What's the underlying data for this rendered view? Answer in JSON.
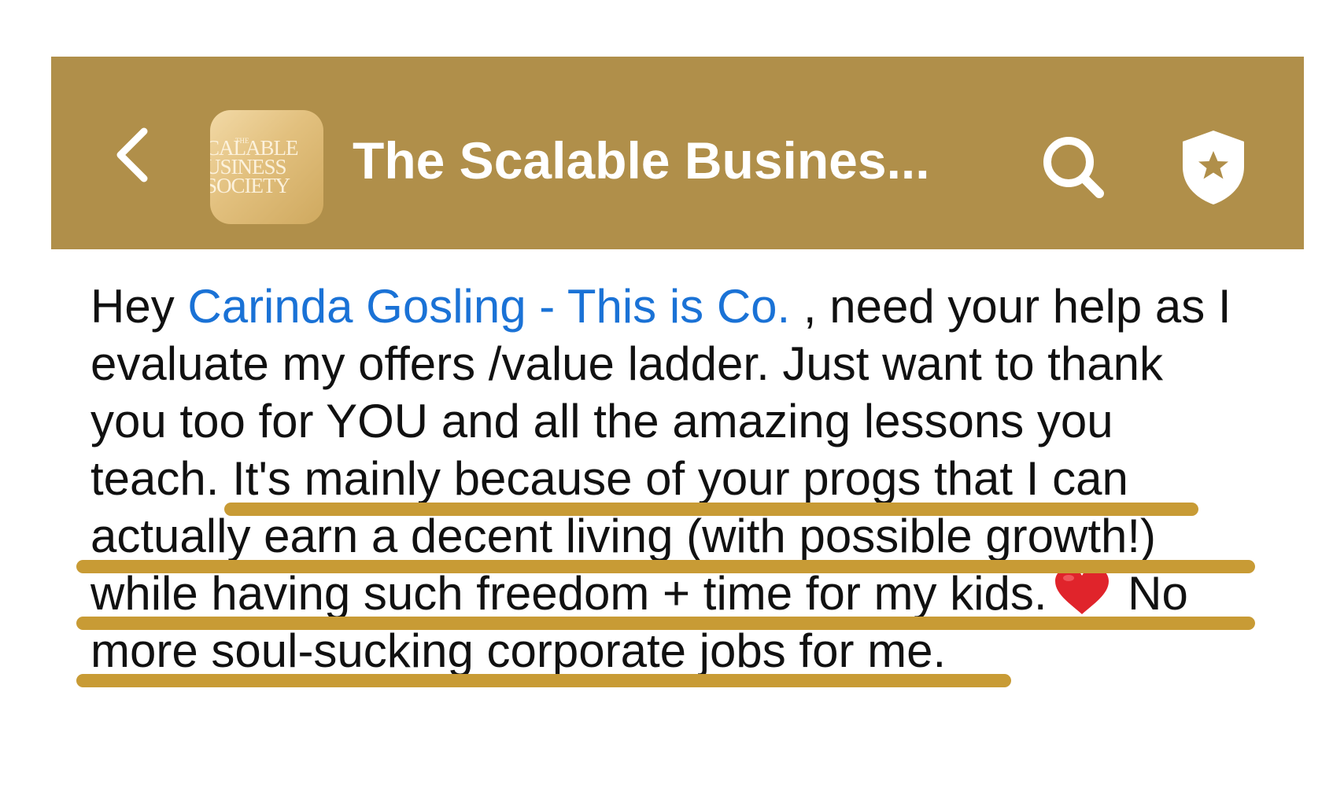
{
  "header": {
    "back_icon": "chevron-left-icon",
    "avatar_text": "CALABLE\nUSINESS\nSOCIETY",
    "avatar_small_text": "THE",
    "title": "The Scalable Busines...",
    "search_icon": "search-icon",
    "shield_icon": "shield-star-icon",
    "background_color": "#b08f4a"
  },
  "message": {
    "line1_prefix": "Hey ",
    "mention": "Carinda Gosling - This is Co.",
    "line1_suffix": " , need your help as I",
    "line2": "evaluate my offers /value ladder. Just want to thank",
    "line3": "you too for YOU and all the amazing lessons you",
    "line4": "teach. It's mainly because of your progs that I can",
    "line5": "actually earn a decent living (with possible growth!)",
    "line6_prefix": "while having such freedom + time for my kids.",
    "line6_suffix": " No",
    "line7": "more soul-sucking corporate jobs for me.",
    "emoji": "heart",
    "mention_color": "#1a72d6",
    "highlight_color": "#c89b35"
  }
}
